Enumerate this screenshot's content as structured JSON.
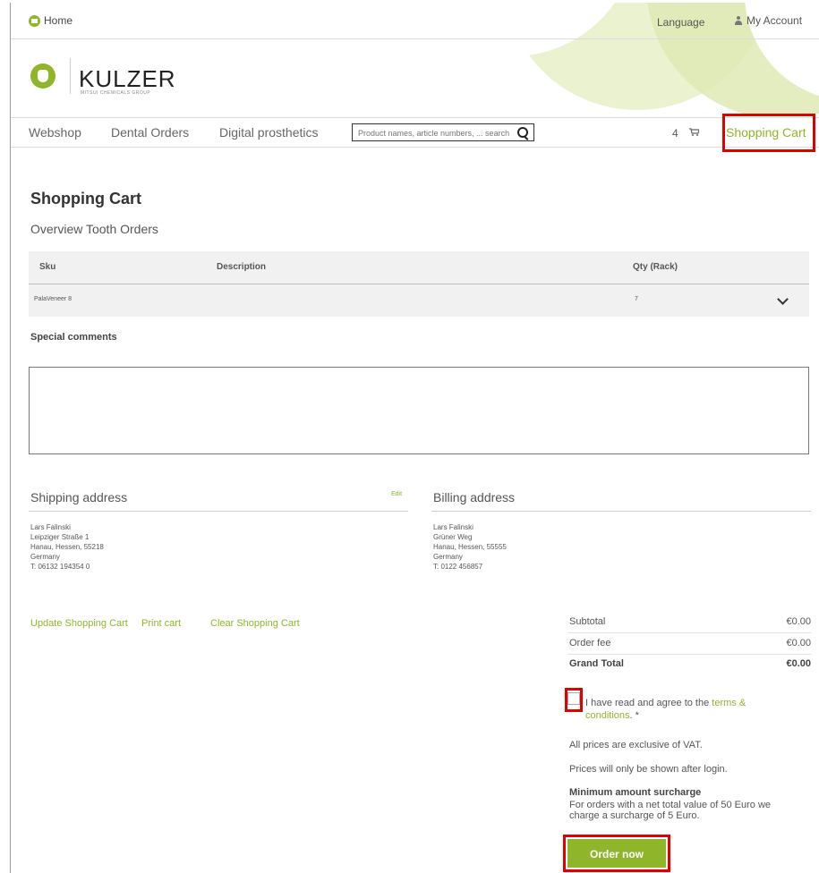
{
  "topbar": {
    "home_label": "Home",
    "language_label": "Language",
    "account_label": "My Account"
  },
  "brand": {
    "name": "KULZER",
    "tagline": "MITSUI CHEMICALS GROUP"
  },
  "nav": {
    "items": [
      {
        "label": "Webshop"
      },
      {
        "label": "Dental Orders"
      },
      {
        "label": "Digital prosthetics"
      }
    ],
    "search_placeholder": "Product names, article numbers, ... search",
    "cart_count": "4",
    "cart_label": "Shopping Cart"
  },
  "page": {
    "title": "Shopping Cart",
    "subtitle": "Overview Tooth Orders"
  },
  "table": {
    "headers": {
      "sku": "Sku",
      "description": "Description",
      "qty": "Qty (Rack)"
    },
    "rows": [
      {
        "sku": "PalaVeneer 8",
        "description": "",
        "qty": "7"
      }
    ]
  },
  "comments": {
    "label": "Special comments",
    "value": ""
  },
  "shipping": {
    "title": "Shipping address",
    "edit_label": "Edit",
    "lines": [
      "Lars Falinski",
      "Leipziger Straße 1",
      "Hanau, Hessen, 55218",
      "Germany",
      "T: 06132 194354 0"
    ]
  },
  "billing": {
    "title": "Billing address",
    "lines": [
      "Lars Falinski",
      "Grüner Weg",
      "Hanau, Hessen, 55555",
      "Germany",
      "T: 0122 456857"
    ]
  },
  "actions": {
    "update": "Update Shopping Cart",
    "print": "Print cart",
    "clear": "Clear Shopping Cart"
  },
  "totals": {
    "subtotal_label": "Subtotal",
    "subtotal": "€0.00",
    "fee_label": "Order fee",
    "fee": "€0.00",
    "grand_label": "Grand Total",
    "grand": "€0.00"
  },
  "terms": {
    "prefix": "I have read and agree to the ",
    "link": "terms & conditions",
    "suffix": ". *",
    "checked": false
  },
  "notes": {
    "vat": "All prices are exclusive of VAT.",
    "login": "Prices will only be shown after login."
  },
  "surcharge": {
    "title": "Minimum amount surcharge",
    "text": "For orders with a net total value of 50 Euro we charge a surcharge of 5 Euro."
  },
  "order_button": "Order now",
  "colors": {
    "accent": "#8fb52b",
    "highlight": "#e00000"
  }
}
